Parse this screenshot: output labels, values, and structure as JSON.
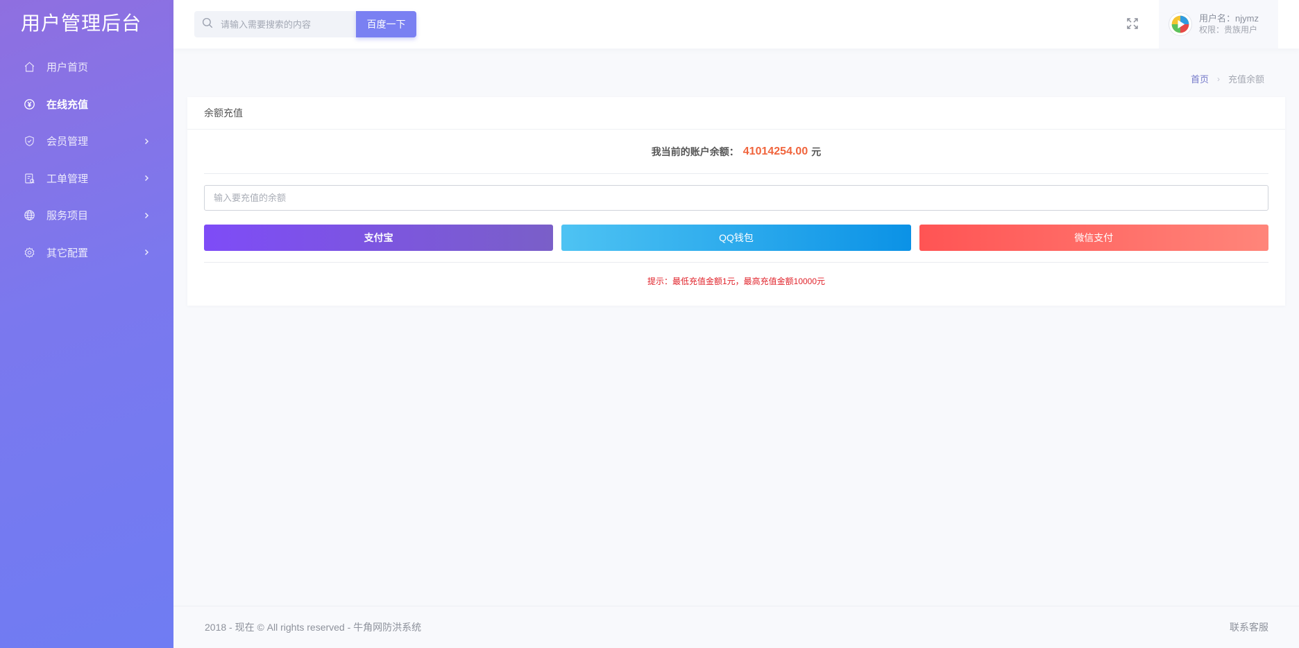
{
  "sidebar": {
    "brand": "用户管理后台",
    "items": [
      {
        "label": "用户首页",
        "icon": "home-icon",
        "active": false,
        "has_children": false
      },
      {
        "label": "在线充值",
        "icon": "yen-icon",
        "active": true,
        "has_children": false
      },
      {
        "label": "会员管理",
        "icon": "shield-icon",
        "active": false,
        "has_children": true
      },
      {
        "label": "工单管理",
        "icon": "ticket-icon",
        "active": false,
        "has_children": true
      },
      {
        "label": "服务项目",
        "icon": "globe-icon",
        "active": false,
        "has_children": true
      },
      {
        "label": "其它配置",
        "icon": "gear-icon",
        "active": false,
        "has_children": true
      }
    ]
  },
  "topbar": {
    "search_placeholder": "请输入需要搜索的内容",
    "search_button": "百度一下",
    "user_name": "用户名：njymz",
    "user_role": "权限：贵族用户"
  },
  "breadcrumb": {
    "home": "首页",
    "current": "充值余额"
  },
  "card": {
    "title": "余额充值",
    "balance_label": "我当前的账户余额：",
    "balance_amount": "41014254.00",
    "balance_unit": "元",
    "amount_placeholder": "输入要充值的余额",
    "pay_buttons": {
      "alipay": "支付宝",
      "qq": "QQ钱包",
      "wechat": "微信支付"
    },
    "tip": "提示：最低充值金额1元，最高充值金额10000元"
  },
  "footer": {
    "copyright": "2018 - 现在 © All rights reserved - 牛角网防洪系统",
    "service": "联系客服"
  },
  "colors": {
    "accent": "#7a80f2",
    "balance": "#f0643c",
    "tip": "#e0222a"
  }
}
